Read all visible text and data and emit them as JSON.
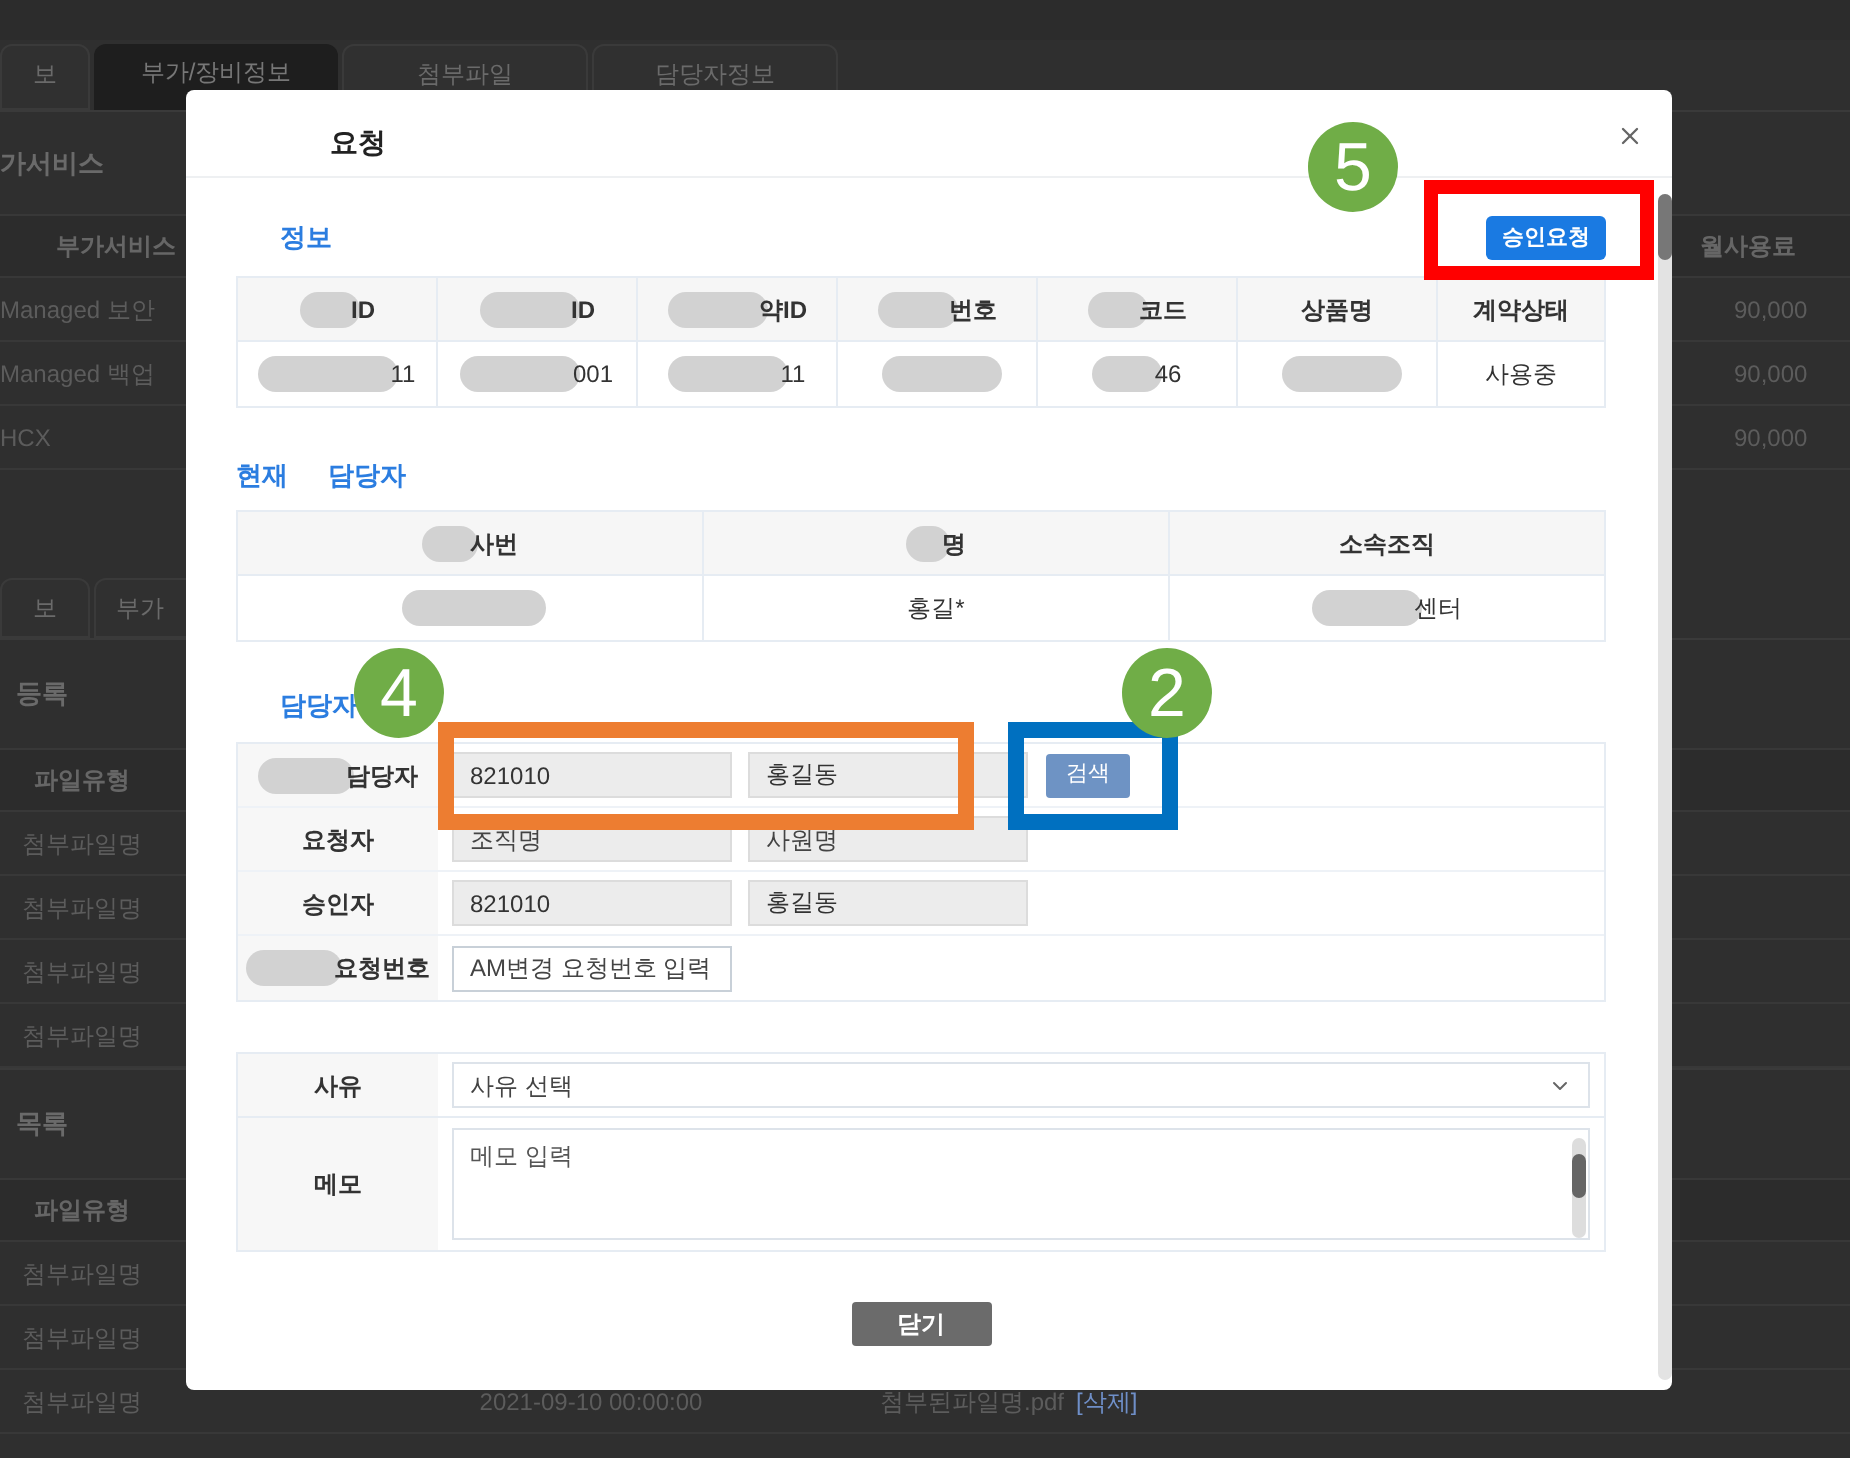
{
  "background": {
    "tabs": [
      {
        "label": "보",
        "selected": false
      },
      {
        "label": "부가/장비정보",
        "selected": true
      },
      {
        "label": "첨부파일",
        "selected": false
      },
      {
        "label": "담당자정보",
        "selected": false
      }
    ],
    "service_section": {
      "title": "가서비스",
      "columns": [
        "부가서비스",
        "월사용료"
      ],
      "rows": [
        [
          "Managed 보안",
          "90,000"
        ],
        [
          "Managed 백업",
          "90,000"
        ],
        [
          "HCX",
          "90,000"
        ]
      ]
    },
    "tabs_2": [
      {
        "label": "보",
        "selected": false
      },
      {
        "label": "부가",
        "selected": false
      }
    ],
    "upload_section": {
      "title": "등록",
      "column": "파일유형",
      "rows": [
        "첨부파일명",
        "첨부파일명",
        "첨부파일명",
        "첨부파일명"
      ]
    },
    "list_section": {
      "title": "목록",
      "column": "파일유형",
      "rows": [
        {
          "type": "첨부파일명"
        },
        {
          "type": "첨부파일명"
        },
        {
          "type": "첨부파일명",
          "date": "2021-09-10 00:00:00",
          "file": "첨부된파일명.pdf",
          "delete": "[삭제]"
        }
      ]
    }
  },
  "dialog": {
    "title": "요청",
    "submit_button": "승인요청",
    "info_section": {
      "title": "정보",
      "columns": [
        {
          "label": "ID",
          "redacted": true
        },
        {
          "label": "ID",
          "redacted": true
        },
        {
          "label": "약ID",
          "redacted": true
        },
        {
          "label": "번호",
          "redacted": true
        },
        {
          "label": "코드",
          "redacted": true
        },
        {
          "label": "상품명",
          "redacted": false
        },
        {
          "label": "계약상태",
          "redacted": false
        }
      ],
      "row": [
        {
          "text": "11",
          "redacted": true
        },
        {
          "text": "001",
          "redacted": true
        },
        {
          "text": "11",
          "redacted": true
        },
        {
          "redacted": true
        },
        {
          "text": "46",
          "redacted": true
        },
        {
          "redacted": true
        },
        {
          "text": "사용중",
          "redacted": false
        }
      ]
    },
    "current_section": {
      "title_parts": [
        "현재",
        "담당자"
      ],
      "columns": [
        {
          "label": "사번",
          "redacted": true
        },
        {
          "label": "명",
          "redacted": true
        },
        {
          "label": "소속조직",
          "redacted": false
        }
      ],
      "row": [
        {
          "redacted": true
        },
        {
          "text": "홍길*",
          "redacted": false
        },
        {
          "text": "센터",
          "redacted": true
        }
      ]
    },
    "assignee_section": {
      "title": "담당자",
      "rows": [
        {
          "label": "담당자",
          "label_redacted": true,
          "fields": [
            {
              "value": "821010",
              "readonly": true
            },
            {
              "value": "홍길동",
              "readonly": true
            }
          ],
          "button": "검색"
        },
        {
          "label": "요청자",
          "label_redacted": false,
          "fields": [
            {
              "placeholder": "조직명",
              "readonly": true
            },
            {
              "placeholder": "사원명",
              "readonly": true
            }
          ]
        },
        {
          "label": "승인자",
          "label_redacted": false,
          "fields": [
            {
              "value": "821010",
              "readonly": true
            },
            {
              "value": "홍길동",
              "readonly": true
            }
          ]
        },
        {
          "label": "요청번호",
          "label_redacted": true,
          "fields": [
            {
              "placeholder": "AM변경 요청번호 입력",
              "readonly": false
            }
          ]
        }
      ]
    },
    "reason_section": {
      "reason": {
        "label": "사유",
        "placeholder": "사유 선택"
      },
      "memo": {
        "label": "메모",
        "placeholder": "메모 입력"
      }
    },
    "close_button": "닫기",
    "callouts": [
      {
        "number": "5",
        "color": "#ff0000"
      },
      {
        "number": "4",
        "color": "#ed7d31"
      },
      {
        "number": "2",
        "color": "#0070c0"
      }
    ]
  }
}
